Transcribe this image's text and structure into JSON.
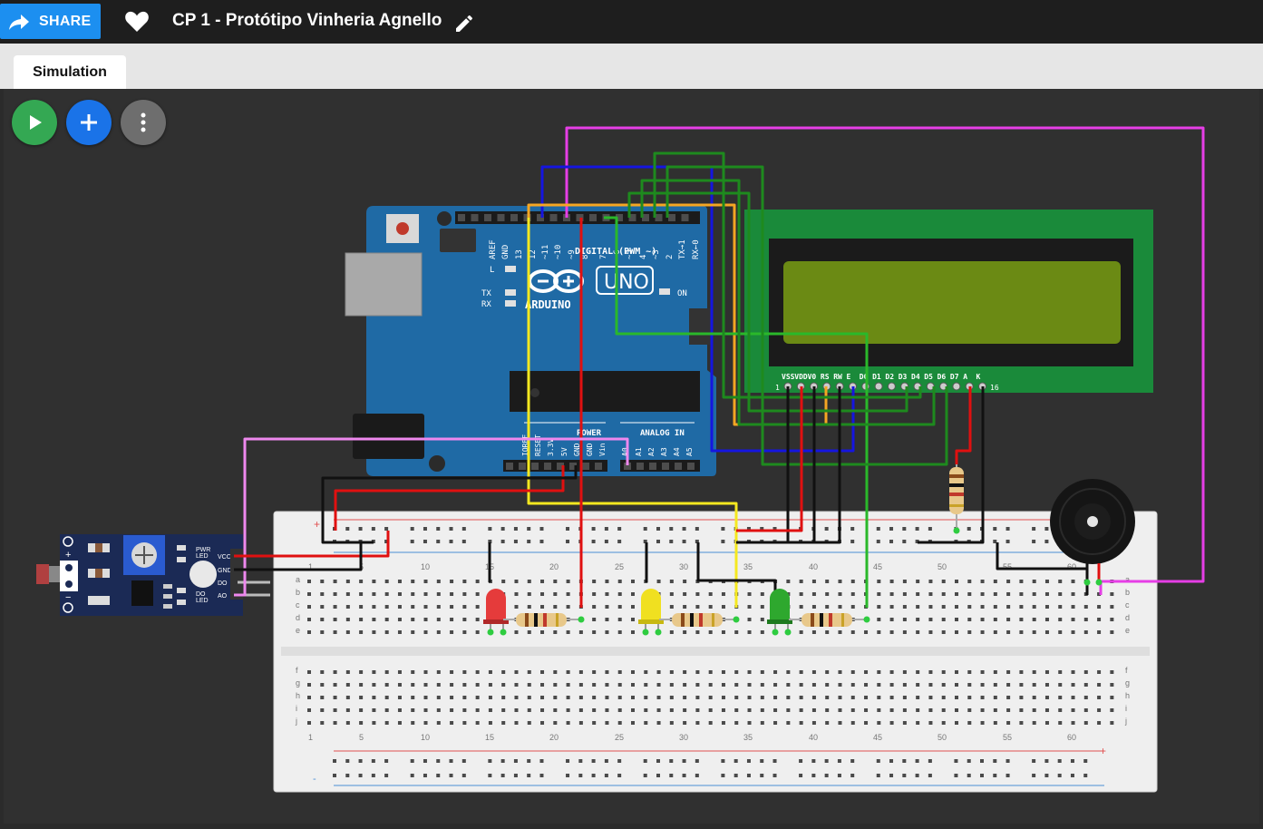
{
  "header": {
    "share_label": "SHARE",
    "project_title": "CP 1 - Protótipo Vinheria Agnello"
  },
  "tabs": [
    {
      "label": "Simulation"
    }
  ],
  "toolbar": {
    "play": "play-icon",
    "add": "plus-icon",
    "more": "more-vert-icon"
  },
  "colors": {
    "share_blue": "#1c8ff0",
    "play_green": "#34a853",
    "add_blue": "#1a73e8",
    "more_gray": "#757575",
    "arduino_blue": "#1f6aa5",
    "lcd_green": "#1a8a3a",
    "lcd_screen": "#6b8a14"
  },
  "arduino": {
    "header_labels": [
      "AREF",
      "GND",
      "13",
      "12",
      "~11",
      "~10",
      "~9",
      "8",
      "7",
      "~6",
      "~5",
      "4",
      "~3",
      "2",
      "TX→1",
      "RX←0"
    ],
    "digital_label": "DIGITAL (PWM ~)",
    "l_label": "L",
    "tx_label": "TX",
    "rx_label": "RX",
    "brand": "ARDUINO",
    "model": "UNO",
    "on_label": "ON",
    "power_label": "POWER",
    "analog_label": "ANALOG IN",
    "power_pins": [
      "IOREF",
      "RESET",
      "3.3V",
      "5V",
      "GND",
      "GND",
      "Vin"
    ],
    "analog_pins": [
      "A0",
      "A1",
      "A2",
      "A3",
      "A4",
      "A5"
    ]
  },
  "lcd": {
    "pins": [
      "VSS",
      "VDD",
      "V0",
      "RS",
      "RW",
      "E",
      "D0",
      "D1",
      "D2",
      "D3",
      "D4",
      "D5",
      "D6",
      "D7",
      "A",
      "K"
    ],
    "first_index": "1",
    "last_index": "16"
  },
  "sensor": {
    "plus": "+",
    "minus": "−",
    "pins": [
      "VCC",
      "GND",
      "DO",
      "AO"
    ],
    "pwr_led": "PWR\nLED",
    "do_led": "DO\nLED"
  },
  "breadboard": {
    "columns": [
      "1",
      "5",
      "10",
      "15",
      "20",
      "25",
      "30",
      "35",
      "40",
      "45",
      "50",
      "55",
      "60"
    ],
    "top_rows": [
      "a",
      "b",
      "c",
      "d",
      "e"
    ],
    "bottom_rows": [
      "f",
      "g",
      "h",
      "i",
      "j"
    ],
    "rail_plus": "+",
    "rail_minus": "-"
  }
}
